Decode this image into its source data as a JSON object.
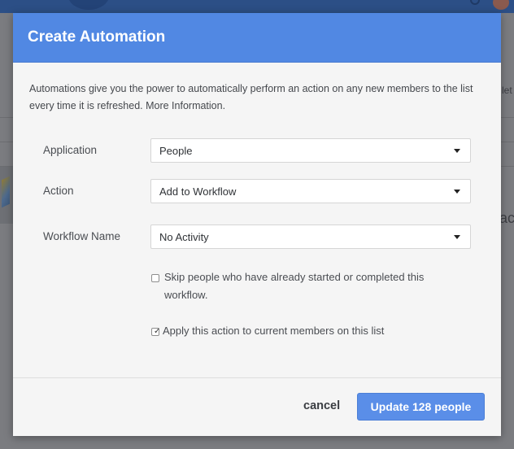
{
  "background": {
    "right_fragment_1": "let",
    "right_fragment_2": "ac"
  },
  "modal": {
    "title": "Create Automation",
    "intro": "Automations give you the power to automatically perform an action on any new members to the list every time it is refreshed. More Information.",
    "fields": [
      {
        "label": "Application",
        "value": "People"
      },
      {
        "label": "Action",
        "value": "Add to Workflow"
      },
      {
        "label": "Workflow Name",
        "value": "No Activity"
      }
    ],
    "options": [
      {
        "label": "Skip people who have already started or completed this workflow.",
        "checked": false
      },
      {
        "label": "Apply this action to current members on this list",
        "checked": true
      }
    ],
    "footer": {
      "cancel_label": "cancel",
      "submit_label": "Update 128 people"
    }
  },
  "colors": {
    "header": "#5188e3",
    "primary_button": "#5a8ee8",
    "overlay": "#7b7c80"
  },
  "icons": {
    "dropdown": "chevron-down-icon",
    "checkbox_checked": "checkmark-icon"
  }
}
